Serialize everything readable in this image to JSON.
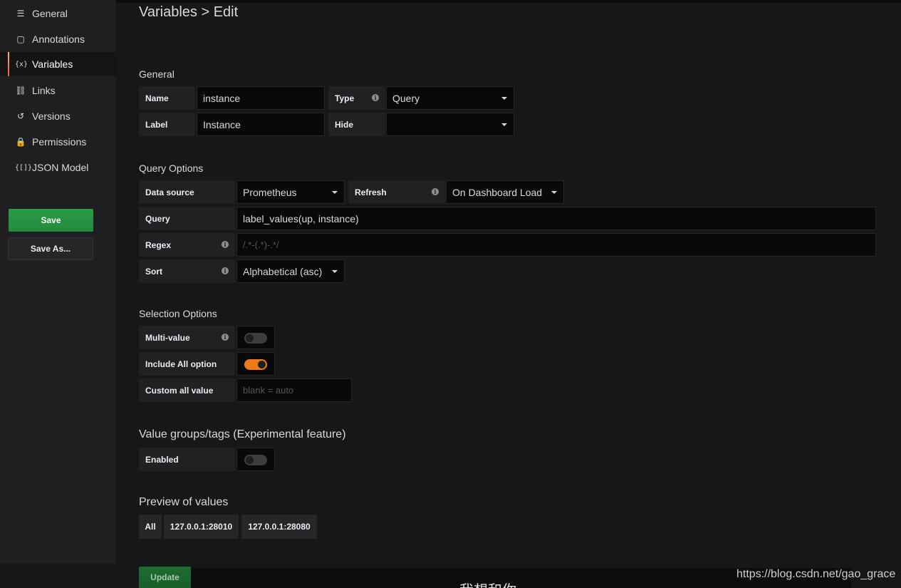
{
  "sidebar": {
    "items": [
      {
        "icon": "sliders-icon",
        "glyph": "☰",
        "label": "General"
      },
      {
        "icon": "comment-icon",
        "glyph": "▢",
        "label": "Annotations"
      },
      {
        "icon": "variable-icon",
        "glyph": "{x}",
        "label": "Variables",
        "active": true
      },
      {
        "icon": "link-icon",
        "glyph": "⛓",
        "label": "Links"
      },
      {
        "icon": "history-icon",
        "glyph": "↺",
        "label": "Versions"
      },
      {
        "icon": "lock-icon",
        "glyph": "🔒",
        "label": "Permissions"
      },
      {
        "icon": "json-icon",
        "glyph": "{[]}",
        "label": "JSON Model"
      }
    ],
    "save_label": "Save",
    "save_as_label": "Save As..."
  },
  "page_title": "Variables > Edit",
  "general": {
    "title": "General",
    "name_label": "Name",
    "name_value": "instance",
    "type_label": "Type",
    "type_value": "Query",
    "label_label": "Label",
    "label_value": "Instance",
    "hide_label": "Hide",
    "hide_value": ""
  },
  "query_options": {
    "title": "Query Options",
    "datasource_label": "Data source",
    "datasource_value": "Prometheus",
    "refresh_label": "Refresh",
    "refresh_value": "On Dashboard Load",
    "query_label": "Query",
    "query_value": "label_values(up, instance)",
    "regex_label": "Regex",
    "regex_placeholder": "/.*-(.*)-.*/",
    "sort_label": "Sort",
    "sort_value": "Alphabetical (asc)"
  },
  "selection_options": {
    "title": "Selection Options",
    "multi_label": "Multi-value",
    "multi_on": false,
    "include_all_label": "Include All option",
    "include_all_on": true,
    "custom_all_label": "Custom all value",
    "custom_all_placeholder": "blank = auto"
  },
  "value_groups": {
    "title": "Value groups/tags (Experimental feature)",
    "enabled_label": "Enabled",
    "enabled_on": false
  },
  "preview": {
    "title": "Preview of values",
    "values": [
      "All",
      "127.0.0.1:28010",
      "127.0.0.1:28080"
    ]
  },
  "update_label": "Update",
  "watermark": "https://blog.csdn.net/gao_grace",
  "overlay_text": "我想和你",
  "colors": {
    "save": "#299c46",
    "toggle_on": "#eb7b18",
    "active_bar": "#ee5a2c"
  }
}
